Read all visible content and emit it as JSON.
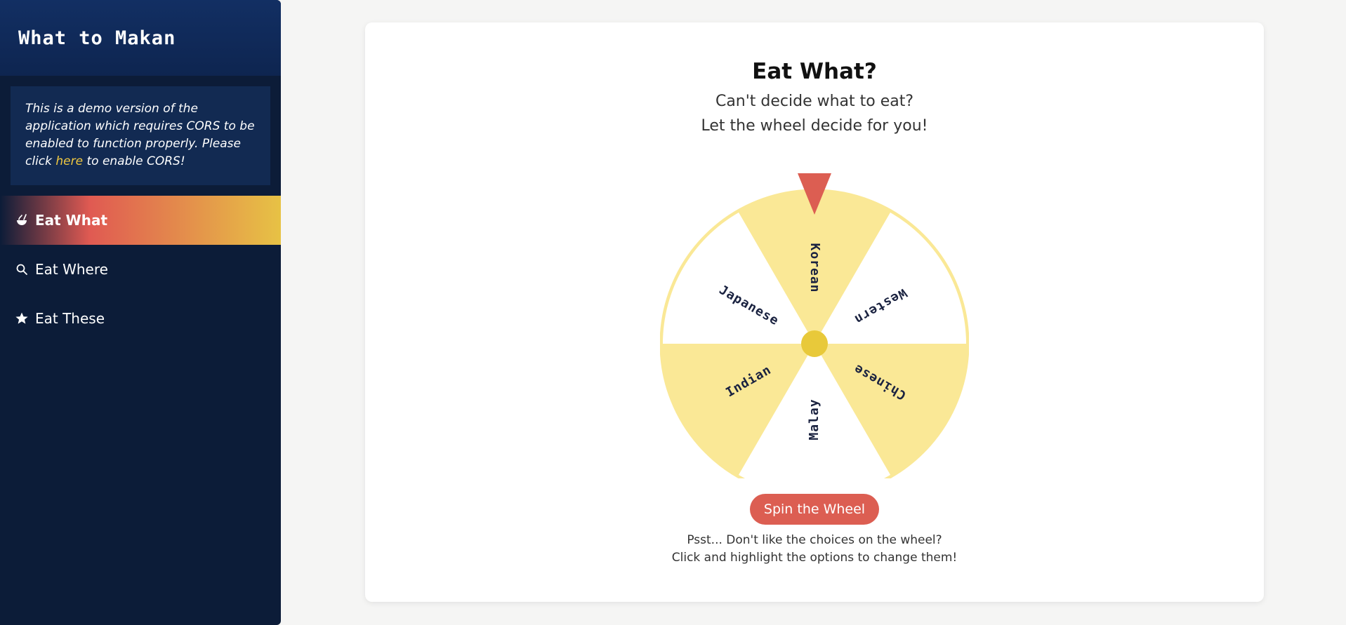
{
  "sidebar": {
    "brand": "What to Makan",
    "notice": {
      "text_before": "This is a demo version of the application which requires CORS to be enabled to function properly. Please click ",
      "link": "here",
      "text_after": " to enable CORS!"
    },
    "items": [
      {
        "label": "Eat What",
        "icon": "food-bowl-icon",
        "active": true
      },
      {
        "label": "Eat Where",
        "icon": "search-icon",
        "active": false
      },
      {
        "label": "Eat These",
        "icon": "star-icon",
        "active": false
      }
    ]
  },
  "main": {
    "title": "Eat What?",
    "subtitle_line1": "Can't decide what to eat?",
    "subtitle_line2": "Let the wheel decide for you!",
    "wheel": {
      "options": [
        "Korean",
        "Western",
        "Chinese",
        "Malay",
        "Indian",
        "Japanese"
      ],
      "colors": [
        "#fae896",
        "#ffffff",
        "#fae896",
        "#ffffff",
        "#fae896",
        "#ffffff"
      ],
      "rim_color": "#fae896",
      "hub_color": "#e8c93a",
      "pointer_color": "#dc5e52",
      "label_color": "#1a2240"
    },
    "spin_button": "Spin the Wheel",
    "hint_line1": "Psst... Don't like the choices on the wheel?",
    "hint_line2": "Click and highlight the options to change them!"
  },
  "colors": {
    "sidebar_bg": "#0c1c38",
    "accent_red": "#dc5e52",
    "accent_yellow": "#e7c245"
  }
}
